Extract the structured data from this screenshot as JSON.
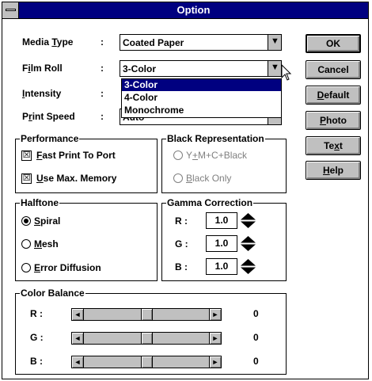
{
  "window": {
    "title": "Option"
  },
  "fields": {
    "media_type": {
      "label": "Media Type",
      "label_pre": "Media ",
      "label_key": "T",
      "label_post": "ype",
      "colon": ":",
      "value": "Coated Paper"
    },
    "film_roll": {
      "label": "Film Roll",
      "label_pre": "F",
      "label_key": "i",
      "label_post": "lm Roll",
      "colon": ":",
      "value": "3-Color"
    },
    "intensity": {
      "label": "Intensity",
      "label_pre": "",
      "label_key": "I",
      "label_post": "ntensity",
      "colon": ":"
    },
    "print_speed": {
      "label": "Print Speed",
      "label_pre": "P",
      "label_key": "r",
      "label_post": "int Speed",
      "colon": ":",
      "value": "Auto"
    }
  },
  "film_roll_options": [
    "3-Color",
    "4-Color",
    "Monochrome"
  ],
  "film_roll_selected": "3-Color",
  "buttons": {
    "ok": "OK",
    "cancel": "Cancel",
    "default": {
      "key": "D",
      "rest": "efault"
    },
    "photo": {
      "key": "P",
      "rest": "hoto"
    },
    "text": {
      "pre": "Te",
      "key": "x",
      "rest": "t"
    },
    "help": {
      "key": "H",
      "rest": "elp"
    }
  },
  "performance": {
    "title": "Performance",
    "fast_print": {
      "key": "F",
      "rest": "ast Print To Port",
      "checked": true
    },
    "max_memory": {
      "key": "U",
      "rest": "se Max. Memory",
      "checked": true
    }
  },
  "black_representation": {
    "title": "Black Representation",
    "ymcblack": {
      "pre": "Y",
      "key": "+",
      "rest": "M+C+Black",
      "enabled": false
    },
    "black_only": {
      "key": "B",
      "rest": "lack Only",
      "enabled": false
    }
  },
  "halftone": {
    "title": "Halftone",
    "spiral": {
      "key": "S",
      "rest": "piral",
      "selected": true
    },
    "mesh": {
      "key": "M",
      "rest": "esh",
      "selected": false
    },
    "error_diffusion": {
      "key": "E",
      "rest": "rror Diffusion",
      "selected": false
    }
  },
  "gamma": {
    "title": "Gamma Correction",
    "r": {
      "label": "R :",
      "value": "1.0"
    },
    "g": {
      "label": "G :",
      "value": "1.0"
    },
    "b": {
      "label": "B :",
      "value": "1.0"
    }
  },
  "color_balance": {
    "title": "Color Balance",
    "r": {
      "label": "R :",
      "value": "0"
    },
    "g": {
      "label": "G :",
      "value": "0"
    },
    "b": {
      "label": "B :",
      "value": "0"
    }
  },
  "icons": {
    "check_mark": "☒",
    "combo_arrow": "▼",
    "scroll_left": "◄",
    "scroll_right": "►"
  },
  "colors": {
    "title_bar": "#000080",
    "face": "#c0c0c0",
    "selection": "#000080"
  }
}
